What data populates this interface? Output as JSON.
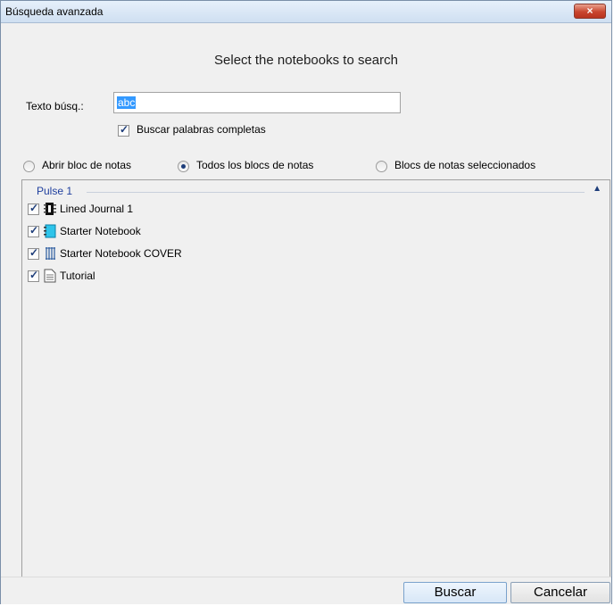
{
  "window": {
    "title": "Búsqueda avanzada",
    "close_label": "×"
  },
  "heading": "Select the notebooks to search",
  "search": {
    "label": "Texto búsq.:",
    "value": "abc"
  },
  "whole_words": {
    "label": "Buscar palabras completas",
    "checked": true
  },
  "scope": {
    "options": [
      {
        "label": "Abrir bloc de notas",
        "selected": false
      },
      {
        "label": "Todos los blocs de notas",
        "selected": true
      },
      {
        "label": "Blocs de notas seleccionados",
        "selected": false
      }
    ]
  },
  "group": {
    "title": "Pulse 1",
    "collapse_glyph": "▲"
  },
  "notebooks": [
    {
      "label": "Lined Journal 1",
      "checked": true,
      "icon": "lined-journal-icon"
    },
    {
      "label": "Starter Notebook",
      "checked": true,
      "icon": "starter-notebook-icon"
    },
    {
      "label": "Starter Notebook COVER",
      "checked": true,
      "icon": "spiral-notebook-icon"
    },
    {
      "label": "Tutorial",
      "checked": true,
      "icon": "document-icon"
    }
  ],
  "buttons": {
    "search": "Buscar",
    "cancel": "Cancelar"
  },
  "colors": {
    "accent": "#3399ff",
    "group_title": "#1f3f9e",
    "close_button": "#c9452e"
  }
}
